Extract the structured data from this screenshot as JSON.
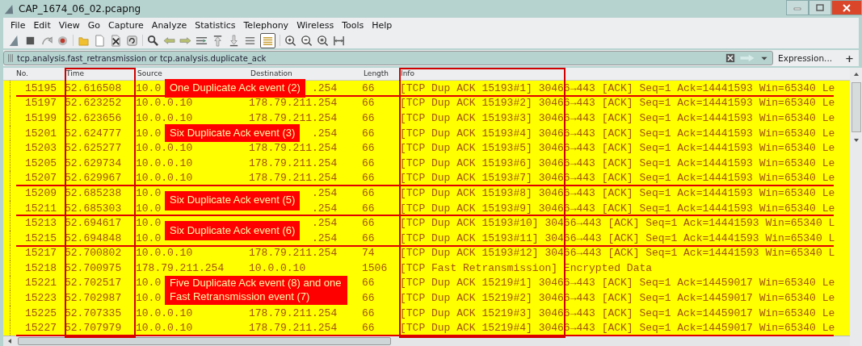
{
  "window": {
    "title": "CAP_1674_06_02.pcapng"
  },
  "menu": [
    "File",
    "Edit",
    "View",
    "Go",
    "Capture",
    "Analyze",
    "Statistics",
    "Telephony",
    "Wireless",
    "Tools",
    "Help"
  ],
  "filter": {
    "value": "tcp.analysis.fast_retransmission or tcp.analysis.duplicate_ack",
    "expression_label": "Expression...",
    "add_label": "+"
  },
  "table": {
    "columns": [
      {
        "label": "No.",
        "framed": false
      },
      {
        "label": "Time",
        "framed": true
      },
      {
        "label": "Source",
        "framed": false
      },
      {
        "label": "Destination",
        "framed": false
      },
      {
        "label": "Length",
        "framed": false
      },
      {
        "label": "Info",
        "framed": true
      }
    ],
    "rows": [
      {
        "no": "15195",
        "time": "52.616508",
        "source": "10.0",
        "destination": ".254",
        "length": "66",
        "info": "[TCP Dup ACK 15193#1] 30466→443 [ACK] Seq=1 Ack=14441593 Win=65340 Le",
        "underlined": true,
        "covered": true,
        "annotation": {
          "text": "One Duplicate Ack event (2)",
          "kind": "single"
        }
      },
      {
        "no": "15197",
        "time": "52.623252",
        "source": "10.0.0.10",
        "destination": "178.79.211.254",
        "length": "66",
        "info": "[TCP Dup ACK 15193#2] 30466→443 [ACK] Seq=1 Ack=14441593 Win=65340 Le",
        "underlined": false
      },
      {
        "no": "15199",
        "time": "52.623656",
        "source": "10.0.0.10",
        "destination": "178.79.211.254",
        "length": "66",
        "info": "[TCP Dup ACK 15193#3] 30466→443 [ACK] Seq=1 Ack=14441593 Win=65340 Le",
        "underlined": false
      },
      {
        "no": "15201",
        "time": "52.624777",
        "source": "10.0",
        "destination": ".254",
        "length": "66",
        "info": "[TCP Dup ACK 15193#4] 30466→443 [ACK] Seq=1 Ack=14441593 Win=65340 Le",
        "underlined": false,
        "covered": true,
        "annotation": {
          "text": "Six Duplicate Ack event (3)",
          "kind": "single"
        }
      },
      {
        "no": "15203",
        "time": "52.625277",
        "source": "10.0.0.10",
        "destination": "178.79.211.254",
        "length": "66",
        "info": "[TCP Dup ACK 15193#5] 30466→443 [ACK] Seq=1 Ack=14441593 Win=65340 Le",
        "underlined": false
      },
      {
        "no": "15205",
        "time": "52.629734",
        "source": "10.0.0.10",
        "destination": "178.79.211.254",
        "length": "66",
        "info": "[TCP Dup ACK 15193#6] 30466→443 [ACK] Seq=1 Ack=14441593 Win=65340 Le",
        "underlined": false
      },
      {
        "no": "15207",
        "time": "52.629967",
        "source": "10.0.0.10",
        "destination": "178.79.211.254",
        "length": "66",
        "info": "[TCP Dup ACK 15193#7] 30466→443 [ACK] Seq=1 Ack=14441593 Win=65340 Le",
        "underlined": true
      },
      {
        "no": "15209",
        "time": "52.685238",
        "source": "10.0",
        "destination": ".254",
        "length": "66",
        "info": "[TCP Dup ACK 15193#8] 30466→443 [ACK] Seq=1 Ack=14441593 Win=65340 Le",
        "underlined": false,
        "covered": true,
        "annotation": {
          "text": "Six Duplicate Ack event (5)",
          "kind": "pair"
        }
      },
      {
        "no": "15211",
        "time": "52.685303",
        "source": "10.0",
        "destination": ".254",
        "length": "66",
        "info": "[TCP Dup ACK 15193#9] 30466→443 [ACK] Seq=1 Ack=14441593 Win=65340 Le",
        "underlined": true,
        "covered": true
      },
      {
        "no": "15213",
        "time": "52.694617",
        "source": "10.0",
        "destination": ".254",
        "length": "66",
        "info": "[TCP Dup ACK 15193#10] 30466→443 [ACK] Seq=1 Ack=14441593 Win=65340 L",
        "underlined": false,
        "covered": true,
        "annotation": {
          "text": "Six Duplicate Ack event (6)",
          "kind": "pair"
        }
      },
      {
        "no": "15215",
        "time": "52.694848",
        "source": "10.0",
        "destination": ".254",
        "length": "66",
        "info": "[TCP Dup ACK 15193#11] 30466→443 [ACK] Seq=1 Ack=14441593 Win=65340 L",
        "underlined": true,
        "covered": true
      },
      {
        "no": "15217",
        "time": "52.700802",
        "source": "10.0.0.10",
        "destination": "178.79.211.254",
        "length": "74",
        "info": "[TCP Dup ACK 15193#12] 30466→443 [ACK] Seq=1 Ack=14441593 Win=65340 L",
        "underlined": false
      },
      {
        "no": "15218",
        "time": "52.700975",
        "source": "178.79.211.254",
        "destination": "10.0.0.10",
        "length": "1506",
        "info": "[TCP Fast Retransmission] Encrypted Data",
        "underlined": false
      },
      {
        "no": "15221",
        "time": "52.702517",
        "source": "10.0",
        "length": "66",
        "info": "[TCP Dup ACK 15219#1] 30466→443 [ACK] Seq=1 Ack=14459017 Win=65340 Le",
        "underlined": false,
        "annotation": {
          "text": "Five Duplicate Ack event (8) and one Fast Retransmission event (7)",
          "kind": "pair"
        }
      },
      {
        "no": "15223",
        "time": "52.702987",
        "source": "10.0",
        "length": "66",
        "info": "[TCP Dup ACK 15219#2] 30466→443 [ACK] Seq=1 Ack=14459017 Win=65340 Le",
        "underlined": false
      },
      {
        "no": "15225",
        "time": "52.707335",
        "source": "10.0.0.10",
        "destination": "178.79.211.254",
        "length": "66",
        "info": "[TCP Dup ACK 15219#3] 30466→443 [ACK] Seq=1 Ack=14459017 Win=65340 Le",
        "underlined": false
      },
      {
        "no": "15227",
        "time": "52.707979",
        "source": "10.0.0.10",
        "destination": "178.79.211.254",
        "length": "66",
        "info": "[TCP Dup ACK 15219#4] 30466→443 [ACK] Seq=1 Ack=14459017 Win=65340 Le",
        "underlined": true
      }
    ]
  }
}
